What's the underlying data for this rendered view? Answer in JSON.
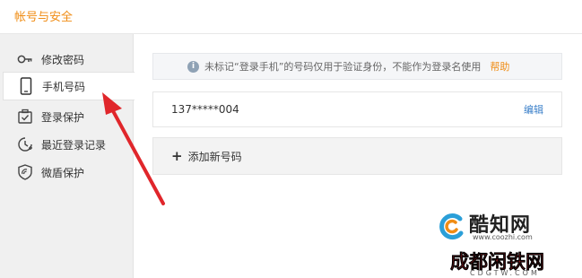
{
  "window": {
    "title": "帐号与安全"
  },
  "sidebar": {
    "items": [
      {
        "label": "修改密码",
        "icon": "key-icon",
        "active": false
      },
      {
        "label": "手机号码",
        "icon": "phone-icon",
        "active": true
      },
      {
        "label": "登录保护",
        "icon": "login-protect-icon",
        "active": false
      },
      {
        "label": "最近登录记录",
        "icon": "login-history-icon",
        "active": false
      },
      {
        "label": "微盾保护",
        "icon": "shield-icon",
        "active": false
      }
    ]
  },
  "notice": {
    "text": "未标记“登录手机”的号码仅用于验证身份，不能作为登录名使用",
    "help_label": "帮助"
  },
  "phone": {
    "number": "137*****004",
    "edit_label": "编辑"
  },
  "add_phone": {
    "icon": "plus-icon",
    "label": "添加新号码"
  },
  "watermarks": {
    "coozhi_brand": "酷知网",
    "coozhi_url": "www.coozhi.com",
    "cdtw_brand": "成都闲铁网",
    "cdtw_url": "CDGTW.COM"
  },
  "colors": {
    "title": "#f08c14",
    "help": "#f08c14",
    "edit": "#3a7fc9",
    "arrow": "#e0262b",
    "sidebar_bg": "#f0f0f0"
  }
}
